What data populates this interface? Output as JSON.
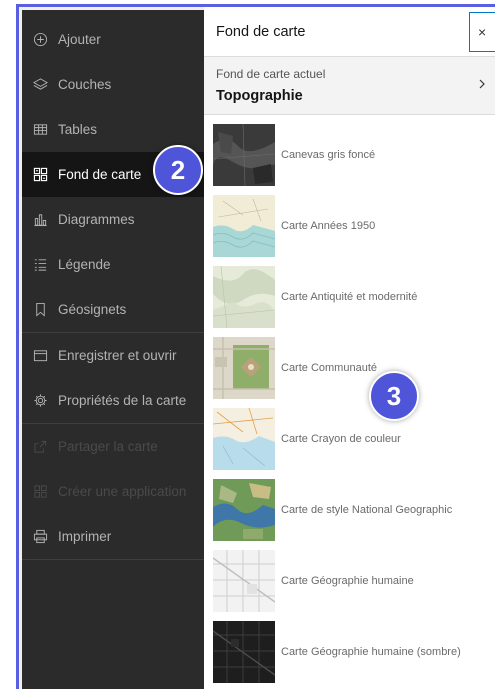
{
  "sidebar": {
    "items": [
      {
        "label": "Ajouter",
        "icon": "plus-circle-icon"
      },
      {
        "label": "Couches",
        "icon": "layers-icon"
      },
      {
        "label": "Tables",
        "icon": "table-icon"
      },
      {
        "label": "Fond de carte",
        "icon": "basemap-icon"
      },
      {
        "label": "Diagrammes",
        "icon": "chart-icon"
      },
      {
        "label": "Légende",
        "icon": "legend-icon"
      },
      {
        "label": "Géosignets",
        "icon": "bookmark-icon"
      },
      {
        "label": "Enregistrer et ouvrir",
        "icon": "folder-icon"
      },
      {
        "label": "Propriétés de la carte",
        "icon": "gear-icon"
      },
      {
        "label": "Partager la carte",
        "icon": "share-icon"
      },
      {
        "label": "Créer une application",
        "icon": "apps-icon"
      },
      {
        "label": "Imprimer",
        "icon": "printer-icon"
      }
    ]
  },
  "badges": {
    "step2": "2",
    "step3": "3",
    "color": "#4f55d9"
  },
  "panel": {
    "title": "Fond de carte",
    "close": "×",
    "current_label": "Fond de carte actuel",
    "current_value": "Topographie",
    "basemaps": [
      "Canevas gris foncé",
      "Carte Années 1950",
      "Carte Antiquité et modernité",
      "Carte Communauté",
      "Carte Crayon de couleur",
      "Carte de style National Geographic",
      "Carte Géographie humaine",
      "Carte Géographie humaine (sombre)"
    ]
  },
  "colors": {
    "accent": "#5a5ee0",
    "sidebar_bg": "#2b2b2b",
    "active_bg": "#151515",
    "close_border": "#007ac2"
  }
}
